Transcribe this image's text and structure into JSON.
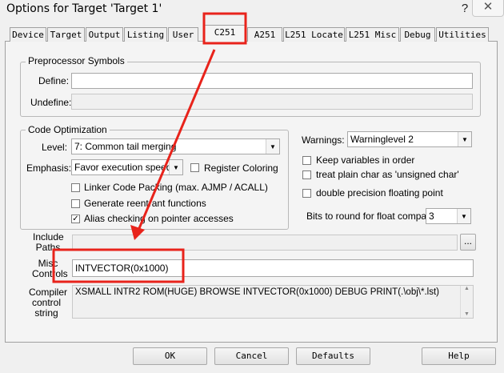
{
  "window": {
    "title": "Options for Target 'Target 1'",
    "help_icon": "?",
    "close_icon": "✕"
  },
  "tabs": [
    {
      "label": "Device"
    },
    {
      "label": "Target"
    },
    {
      "label": "Output"
    },
    {
      "label": "Listing"
    },
    {
      "label": "User"
    },
    {
      "label": "C251"
    },
    {
      "label": "A251"
    },
    {
      "label": "L251 Locate"
    },
    {
      "label": "L251 Misc"
    },
    {
      "label": "Debug"
    },
    {
      "label": "Utilities"
    }
  ],
  "active_tab": "C251",
  "preprocessor": {
    "title": "Preprocessor Symbols",
    "define_label": "Define:",
    "define_value": "",
    "undefine_label": "Undefine:",
    "undefine_value": ""
  },
  "code_optimization": {
    "title": "Code Optimization",
    "level_label": "Level:",
    "level_value": "7: Common tail merging",
    "emphasis_label": "Emphasis:",
    "emphasis_value": "Favor execution speed",
    "register_coloring": {
      "label": "Register Coloring",
      "checked": false
    },
    "linker_packing": {
      "label": "Linker Code Packing (max. AJMP / ACALL)",
      "checked": false
    },
    "reentrant": {
      "label": "Generate reentrant functions",
      "checked": false
    },
    "alias": {
      "label": "Alias checking on pointer accesses",
      "checked": true
    }
  },
  "warnings": {
    "label": "Warnings:",
    "value": "Warninglevel 2",
    "keep_vars": {
      "label": "Keep variables in order",
      "checked": false
    },
    "plain_char": {
      "label": "treat plain char as 'unsigned char'",
      "checked": false
    },
    "double_precision": {
      "label": "double precision floating point",
      "checked": false
    },
    "bits_label": "Bits to round for float compare:",
    "bits_value": "3"
  },
  "include": {
    "label": "Include Paths",
    "value": "",
    "browse_label": "..."
  },
  "misc": {
    "label": "Misc Controls",
    "value": "INTVECTOR(0x1000)"
  },
  "compiler": {
    "label": "Compiler control string",
    "value": "XSMALL INTR2 ROM(HUGE) BROWSE INTVECTOR(0x1000) DEBUG PRINT(.\\obj\\*.lst)"
  },
  "buttons": {
    "ok": "OK",
    "cancel": "Cancel",
    "defaults": "Defaults",
    "help": "Help"
  },
  "annotation": {
    "color": "#e8231b"
  }
}
